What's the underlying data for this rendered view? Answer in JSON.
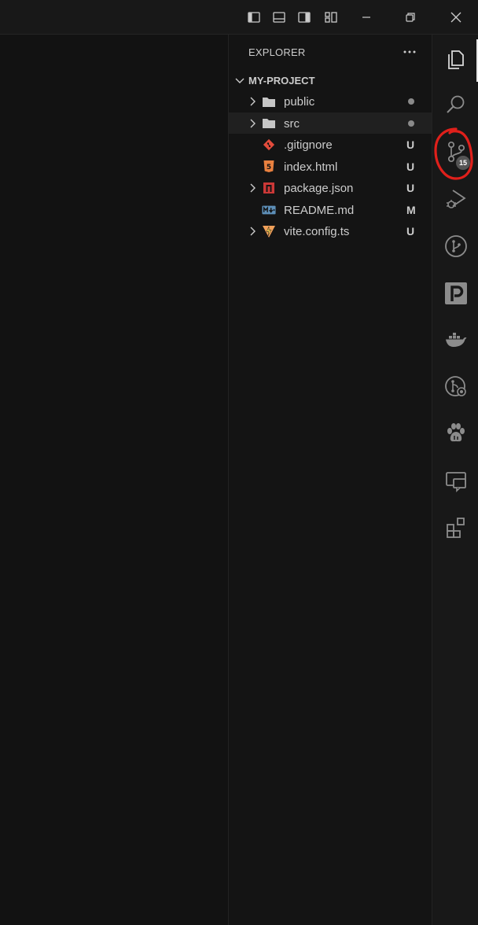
{
  "titlebar": {
    "icons": [
      "toggle-primary-sidebar-icon",
      "toggle-panel-icon",
      "toggle-secondary-sidebar-icon",
      "customize-layout-icon",
      "minimize-icon",
      "restore-icon",
      "close-icon"
    ]
  },
  "sidebar": {
    "title": "EXPLORER",
    "more_label": "···",
    "project": "MY-PROJECT",
    "items": [
      {
        "label": "public",
        "type": "folder",
        "status": "dot"
      },
      {
        "label": "src",
        "type": "folder",
        "status": "dot"
      },
      {
        "label": ".gitignore",
        "type": "file",
        "icon": "git-icon",
        "status": "U"
      },
      {
        "label": "index.html",
        "type": "file",
        "icon": "html-icon",
        "status": "U"
      },
      {
        "label": "package.json",
        "type": "folder",
        "icon": "npm-icon",
        "status": "U"
      },
      {
        "label": "README.md",
        "type": "file",
        "icon": "markdown-icon",
        "status": "M"
      },
      {
        "label": "vite.config.ts",
        "type": "folder",
        "icon": "vite-icon",
        "status": "U"
      }
    ]
  },
  "activity": {
    "items": [
      {
        "name": "explorer-icon",
        "active": true
      },
      {
        "name": "search-icon"
      },
      {
        "name": "source-control-icon",
        "badge": "15"
      },
      {
        "name": "run-debug-icon"
      },
      {
        "name": "git-graph-icon"
      },
      {
        "name": "pdf-icon"
      },
      {
        "name": "docker-icon"
      },
      {
        "name": "remote-git-icon"
      },
      {
        "name": "paw-icon"
      },
      {
        "name": "remote-explorer-icon"
      },
      {
        "name": "extensions-icon"
      }
    ]
  },
  "colors": {
    "untracked": "#73c991",
    "modified": "#e2c08d",
    "annotation": "#e0201b"
  }
}
